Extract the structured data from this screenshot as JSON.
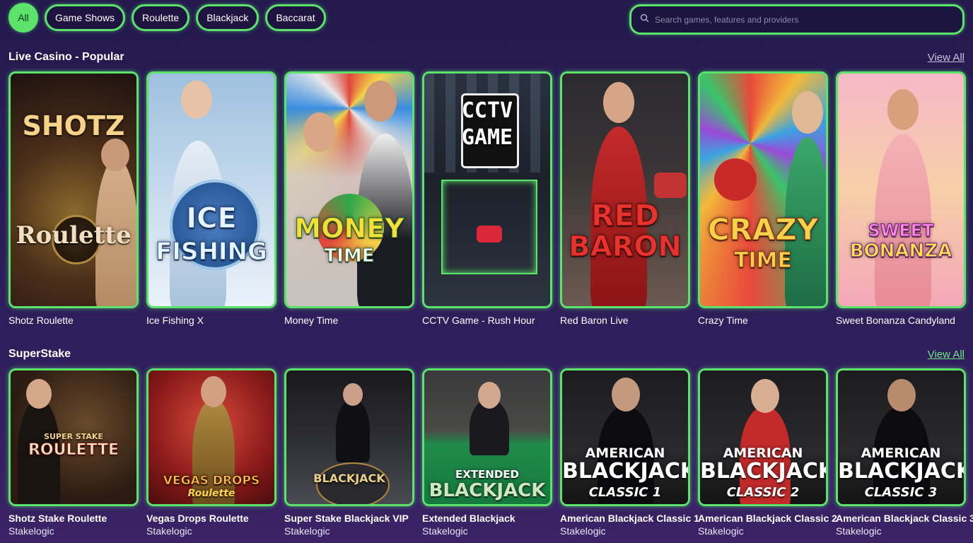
{
  "filters": [
    "All",
    "Game Shows",
    "Roulette",
    "Blackjack",
    "Baccarat"
  ],
  "search": {
    "placeholder": "Search games, features and providers"
  },
  "sections": [
    {
      "title": "Live Casino - Popular",
      "view_all": "View All",
      "games": [
        {
          "name": "Shotz Roulette",
          "logo_lines": [
            "SHOTZ",
            "Roulette"
          ]
        },
        {
          "name": "Ice Fishing X",
          "logo_lines": [
            "ICE",
            "FISHING"
          ]
        },
        {
          "name": "Money Time",
          "logo_lines": [
            "MONEY",
            "TIME"
          ]
        },
        {
          "name": "CCTV Game - Rush Hour",
          "logo_lines": [
            "CCTV",
            "GAME"
          ]
        },
        {
          "name": "Red Baron Live",
          "logo_lines": [
            "RED",
            "BARON"
          ]
        },
        {
          "name": "Crazy Time",
          "logo_lines": [
            "CRAZY",
            "TIME"
          ]
        },
        {
          "name": "Sweet Bonanza Candyland",
          "logo_lines": [
            "SWEET",
            "BONANZA"
          ]
        }
      ]
    },
    {
      "title": "SuperStake",
      "view_all": "View All",
      "games": [
        {
          "name": "Shotz Stake Roulette",
          "provider": "Stakelogic",
          "logo_lines": [
            "SUPER STAKE",
            "ROULETTE"
          ]
        },
        {
          "name": "Vegas Drops Roulette",
          "provider": "Stakelogic",
          "logo_lines": [
            "VEGAS DROPS",
            "Roulette"
          ]
        },
        {
          "name": "Super Stake Blackjack VIP",
          "provider": "Stakelogic",
          "logo_lines": [
            "",
            "BLACKJACK"
          ]
        },
        {
          "name": "Extended Blackjack",
          "provider": "Stakelogic",
          "logo_lines": [
            "EXTENDED",
            "BLACKJACK"
          ]
        },
        {
          "name": "American Blackjack Classic 1",
          "provider": "Stakelogic",
          "logo_lines": [
            "AMERICAN",
            "BLACKJACK",
            "CLASSIC 1"
          ]
        },
        {
          "name": "American Blackjack Classic 2",
          "provider": "Stakelogic",
          "logo_lines": [
            "AMERICAN",
            "BLACKJACK",
            "CLASSIC 2"
          ]
        },
        {
          "name": "American Blackjack Classic 3",
          "provider": "Stakelogic",
          "logo_lines": [
            "AMERICAN",
            "BLACKJACK",
            "CLASSIC 3"
          ]
        }
      ]
    }
  ],
  "colors": {
    "accent": "#5be36b",
    "background": "#2a1d58"
  }
}
